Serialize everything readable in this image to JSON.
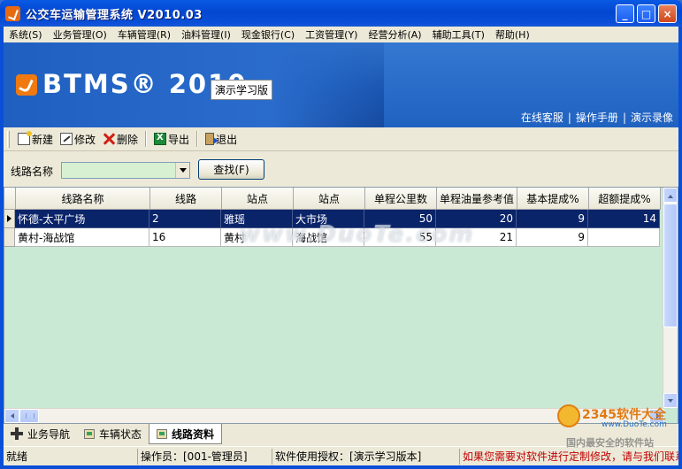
{
  "window": {
    "title": "公交车运输管理系统 V2010.03",
    "min": "_",
    "max": "□",
    "close": "×"
  },
  "menu": [
    "系统(S)",
    "业务管理(O)",
    "车辆管理(R)",
    "油料管理(I)",
    "现金银行(C)",
    "工资管理(Y)",
    "经营分析(A)",
    "辅助工具(T)",
    "帮助(H)"
  ],
  "banner": {
    "logo": "BTMS® 2010",
    "edition": "演示学习版",
    "links": [
      "在线客服",
      "操作手册",
      "演示录像"
    ],
    "separator": "|"
  },
  "toolbar": {
    "new": "新建",
    "edit": "修改",
    "delete": "删除",
    "export": "导出",
    "exit": "退出"
  },
  "filter": {
    "label": "线路名称",
    "value": "",
    "search_button": "查找(F)"
  },
  "grid": {
    "columns": [
      "线路名称",
      "线路",
      "站点",
      "站点",
      "单程公里数",
      "单程油量参考值",
      "基本提成%",
      "超额提成%"
    ],
    "rows": [
      [
        "怀德-太平广场",
        "2",
        "雅瑶",
        "大市场",
        "50",
        "20",
        "9",
        "14"
      ],
      [
        "黄村-海战馆",
        "16",
        "黄村",
        "海战馆",
        "55",
        "21",
        "9",
        ""
      ]
    ]
  },
  "tabs": [
    "业务导航",
    "车辆状态",
    "线路资料"
  ],
  "status": {
    "ready": "就绪",
    "operator": "操作员：[001-管理员]",
    "license": "软件使用授权：[演示学习版本]",
    "notice": "如果您需要对软件进行定制修改，请与我们联系"
  },
  "watermark": {
    "text": "www.DuoTe.com",
    "brand": "2345软件大全",
    "domain": "www.DuoTe.com",
    "slogan": "国内最安全的软件站"
  },
  "colors": {
    "selected_row": "#0a246a",
    "grid_background": "#c9e9d4",
    "banner": "#1a56b2",
    "notice_text": "#c00000"
  }
}
